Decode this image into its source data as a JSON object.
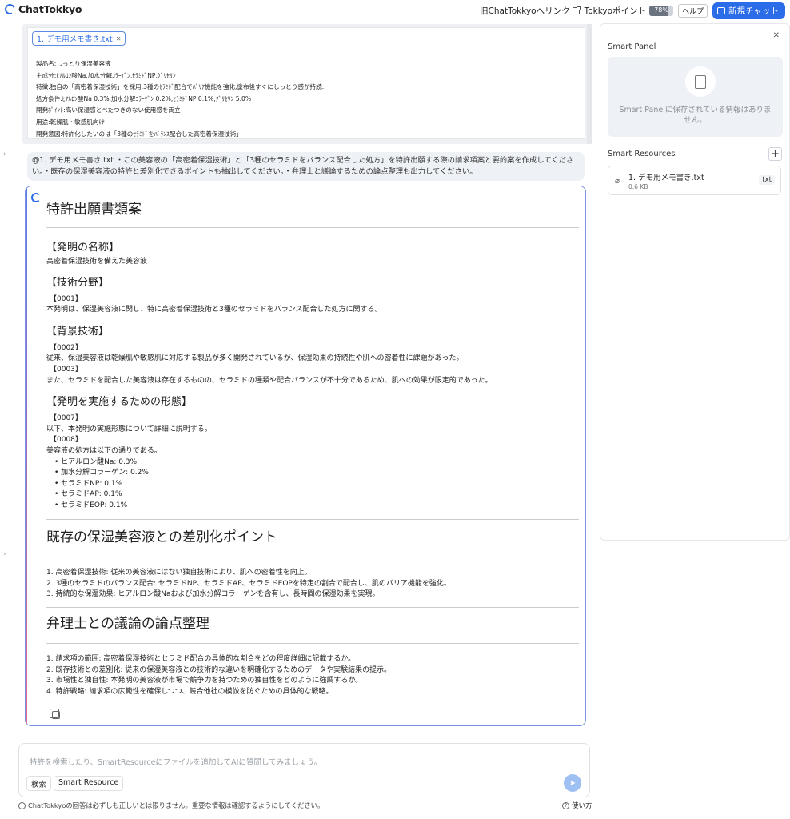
{
  "header": {
    "app_name": "ChatTokkyo",
    "old_link": "旧ChatTokkyoへリンク",
    "points_label": "Tokkyoポイント",
    "points_percent": "78%",
    "points_fraction": 0.78,
    "help": "ヘルプ",
    "new_chat": "新規チャット"
  },
  "document": {
    "file_chip": "1. デモ用メモ書き.txt",
    "lines": [
      "製品名:しっとり保湿美容液",
      "主成分:ﾋｱﾙﾛﾝ酸Na,加水分解ｺﾗｰｹﾞﾝ,ｾﾗﾐﾄﾞNP,ｸﾞﾘｾﾘﾝ",
      "特徴:独自の「高密着保湿技術」を採用,3種のｾﾗﾐﾄﾞ配合でﾊﾞﾘｱ機能を強化,塗布後すぐにしっとり感が持続.",
      "処方条件:ﾋｱﾙﾛﾝ酸Na 0.3%,加水分解ｺﾗｰｹﾞﾝ 0.2%,ｾﾗﾐﾄﾞNP 0.1%,ｸﾞﾘｾﾘﾝ 5.0%",
      "開発ﾎﾟｲﾝﾄ:高い保湿感とべたつきのない使用感を両立",
      "用途:乾燥肌・敏感肌向け",
      "開発意図:特許化したいのは「3種のｾﾗﾐﾄﾞをﾊﾞﾗﾝｽ配合した高密着保湿技術」"
    ]
  },
  "user_message": "@1. デモ用メモ書き.txt ・この美容液の「高密着保湿技術」と「3種のセラミドをバランス配合した処方」を特許出願する際の請求項案と要約案を作成してください。・既存の保湿美容液の特許と差別化できるポイントも抽出してください。・弁理士と議論するための論点整理も出力してください。",
  "answer": {
    "title": "特許出願書類案",
    "sec_name_h": "【発明の名称】",
    "sec_name_p": "高密着保湿技術を備えた美容液",
    "sec_field_h": "【技術分野】",
    "p0001_no": "【0001】",
    "p0001": "本発明は、保湿美容液に関し、特に高密着保湿技術と3種のセラミドをバランス配合した処方に関する。",
    "sec_bg_h": "【背景技術】",
    "p0002_no": "【0002】",
    "p0002": "従来、保湿美容液は乾燥肌や敏感肌に対応する製品が多く開発されているが、保湿効果の持続性や肌への密着性に課題があった。",
    "p0003_no": "【0003】",
    "p0003": "また、セラミドを配合した美容液は存在するものの、セラミドの種類や配合バランスが不十分であるため、肌への効果が限定的であった。",
    "sec_embod_h": "【発明を実施するための形態】",
    "p0007_no": "【0007】",
    "p0007": "以下、本発明の実施形態について詳細に説明する。",
    "p0008_no": "【0008】",
    "p0008": "美容液の処方は以下の通りである。",
    "formula": [
      "ヒアルロン酸Na: 0.3%",
      "加水分解コラーゲン: 0.2%",
      "セラミドNP: 0.1%",
      "セラミドAP: 0.1%",
      "セラミドEOP: 0.1%"
    ],
    "diff_title": "既存の保湿美容液との差別化ポイント",
    "diff_items": [
      "1. 高密着保湿技術: 従来の美容液にはない独自技術により、肌への密着性を向上。",
      "2. 3種のセラミドのバランス配合: セラミドNP、セラミドAP、セラミドEOPを特定の割合で配合し、肌のバリア機能を強化。",
      "3. 持続的な保湿効果: ヒアルロン酸Naおよび加水分解コラーゲンを含有し、長時間の保湿効果を実現。"
    ],
    "issues_title": "弁理士との議論の論点整理",
    "issues_items": [
      "1. 請求項の範囲: 高密着保湿技術とセラミド配合の具体的な割合をどの程度詳細に記載するか。",
      "2. 既存技術との差別化: 従来の保湿美容液との技術的な違いを明確化するためのデータや実験結果の提示。",
      "3. 市場性と独自性: 本発明の美容液が市場で競争力を持つための独自性をどのように強調するか。",
      "4. 特許戦略: 請求項の広範性を確保しつつ、競合他社の模倣を防ぐための具体的な戦略。"
    ]
  },
  "input": {
    "placeholder": "特許を検索したり、SmartResourceにファイルを追加してAIに質問してみましょう。",
    "search_btn": "検索",
    "smart_resource_btn": "Smart Resource"
  },
  "footer": {
    "disclaimer": "ChatTokkyoの回答は必ずしも正しいとは限りません。重要な情報は確認するようにしてください。",
    "usage": "使い方"
  },
  "panel": {
    "title": "Smart Panel",
    "empty_text": "Smart Panelに保存されている情報はありません。",
    "resources_title": "Smart Resources",
    "resource_name": "1. デモ用メモ書き.txt",
    "resource_size": "0.6 KB",
    "resource_type": "txt"
  }
}
